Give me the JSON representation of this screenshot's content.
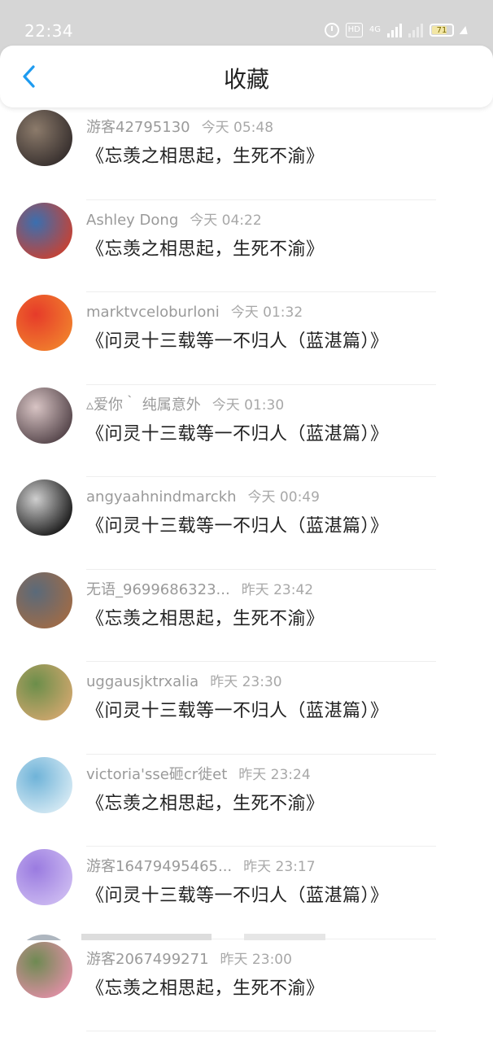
{
  "status_bar": {
    "time": "22:34",
    "hd_label": "HD",
    "network_label": "4G",
    "battery": "71",
    "colors": {
      "background": "#d6d6d6",
      "battery": "#f2e6a5"
    }
  },
  "header": {
    "title": "收藏",
    "back_icon": "chevron-left-icon",
    "accent": "#1e9bf0"
  },
  "favorites": [
    {
      "user": "游客42795130",
      "time": "今天 05:48",
      "title": "《忘羡之相思起，生死不渝》",
      "avatar_colors": [
        "#3a3230",
        "#8c7b6b"
      ]
    },
    {
      "user": "Ashley Dong",
      "time": "今天 04:22",
      "title": "《忘羡之相思起，生死不渝》",
      "avatar_colors": [
        "#c0443a",
        "#3a6fb0"
      ]
    },
    {
      "user": "marktvceloburloni",
      "time": "今天 01:32",
      "title": "《问灵十三载等一不归人（蓝湛篇）》",
      "avatar_colors": [
        "#f07b2c",
        "#e63b2a"
      ]
    },
    {
      "user": "▵爱你｀ 纯属意外",
      "time": "今天 01:30",
      "title": "《问灵十三载等一不归人（蓝湛篇）》",
      "avatar_colors": [
        "#5a4a4f",
        "#d8c4c4"
      ]
    },
    {
      "user": "angyaahnindmarckh",
      "time": "今天 00:49",
      "title": "《问灵十三载等一不归人（蓝湛篇）》",
      "avatar_colors": [
        "#222222",
        "#cfcfcf"
      ]
    },
    {
      "user": "无语_9699686323...",
      "time": "昨天 23:42",
      "title": "《忘羡之相思起，生死不渝》",
      "avatar_colors": [
        "#9b6b4a",
        "#5a6a7a"
      ]
    },
    {
      "user": "uggausjktrxalia",
      "time": "昨天 23:30",
      "title": "《问灵十三载等一不归人（蓝湛篇）》",
      "avatar_colors": [
        "#c9a56b",
        "#6b8e4a"
      ]
    },
    {
      "user": "victoria'sse砸cr徙et",
      "time": "昨天 23:24",
      "title": "《忘羡之相思起，生死不渝》",
      "avatar_colors": [
        "#cfe6f2",
        "#6fb3d8"
      ]
    },
    {
      "user": "游客16479495465...",
      "time": "昨天 23:17",
      "title": "《问灵十三载等一不归人（蓝湛篇）》",
      "avatar_colors": [
        "#c9b6f0",
        "#9a7be0"
      ]
    },
    {
      "user": "游客2067499271",
      "time": "昨天 23:00",
      "title": "《忘羡之相思起，生死不渝》",
      "avatar_colors": [
        "#d98fa0",
        "#6e8a52"
      ]
    }
  ]
}
